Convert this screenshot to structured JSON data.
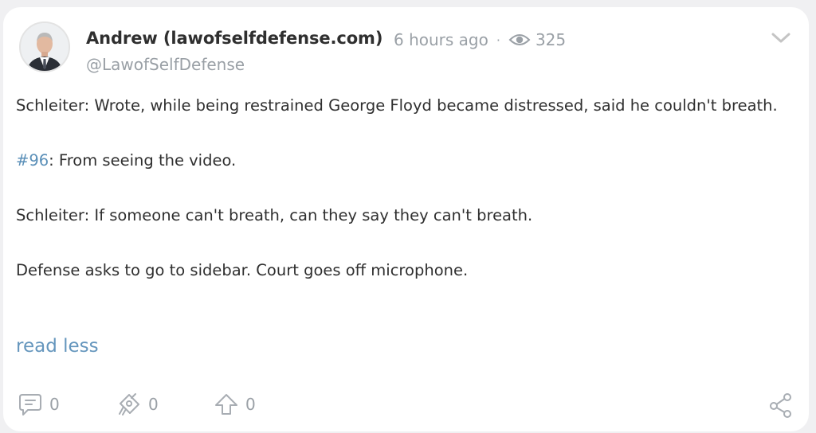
{
  "post": {
    "author_name": "Andrew (lawofselfdefense.com)",
    "handle": "@LawofSelfDefense",
    "time_ago": "6 hours ago",
    "separator": "·",
    "views": "325",
    "paragraphs": {
      "p1": "Schleiter: Wrote, while being restrained George Floyd became distressed, said he couldn't breath.",
      "p2_tag": "#96",
      "p2_rest": ": From seeing the video.",
      "p3": "Schleiter: If someone can't breath, can they say they can't breath.",
      "p4": "Defense asks to go to sidebar. Court goes off microphone."
    },
    "read_less_label": "read less"
  },
  "actions": {
    "comments": "0",
    "tips": "0",
    "upvotes": "0"
  },
  "icons": {
    "views": "eye-icon",
    "expand": "chevron-down-icon",
    "comments": "comment-icon",
    "tips": "tip-icon",
    "upvotes": "upvote-arrow-icon",
    "share": "share-icon"
  },
  "colors": {
    "link": "#5a8fb8",
    "muted": "#9aa0a6",
    "text": "#2f2f2f",
    "card": "#ffffff",
    "background": "#f0f0f2"
  }
}
